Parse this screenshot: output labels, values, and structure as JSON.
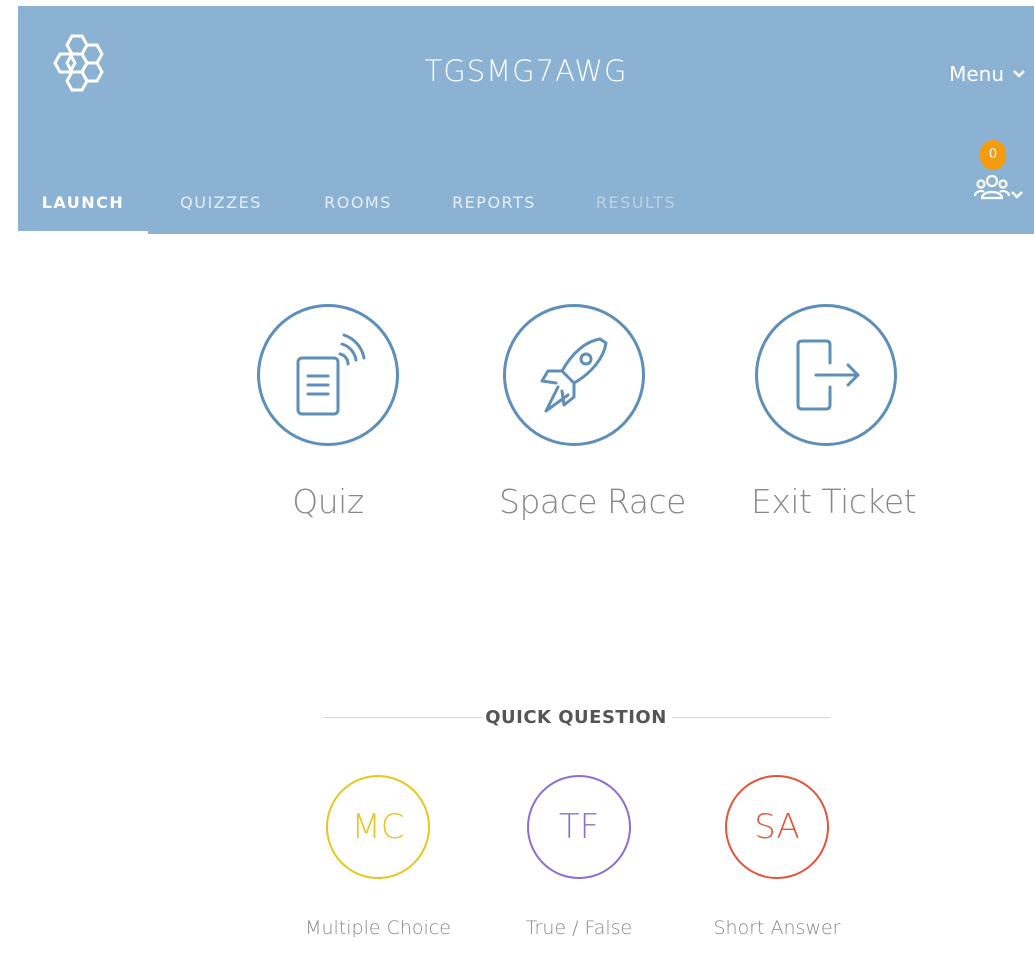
{
  "header": {
    "room_code": "TGSMG7AWG",
    "menu_label": "Menu",
    "student_count": "0",
    "tabs": [
      {
        "label": "LAUNCH"
      },
      {
        "label": "QUIZZES"
      },
      {
        "label": "ROOMS"
      },
      {
        "label": "REPORTS"
      },
      {
        "label": "RESULTS"
      }
    ]
  },
  "launch_options": [
    {
      "label": "Quiz",
      "icon": "quiz-device-icon"
    },
    {
      "label": "Space Race",
      "icon": "rocket-icon"
    },
    {
      "label": "Exit Ticket",
      "icon": "exit-door-icon"
    }
  ],
  "quick_question": {
    "title": "QUICK QUESTION",
    "options": [
      {
        "abbr": "MC",
        "label": "Multiple Choice",
        "color": "#e8c51f"
      },
      {
        "abbr": "TF",
        "label": "True / False",
        "color": "#8a6fd4"
      },
      {
        "abbr": "SA",
        "label": "Short Answer",
        "color": "#e2553a"
      }
    ]
  },
  "colors": {
    "header_bg": "#8bb2d3",
    "circle_stroke": "#5d8fb9",
    "badge": "#f39c12"
  }
}
